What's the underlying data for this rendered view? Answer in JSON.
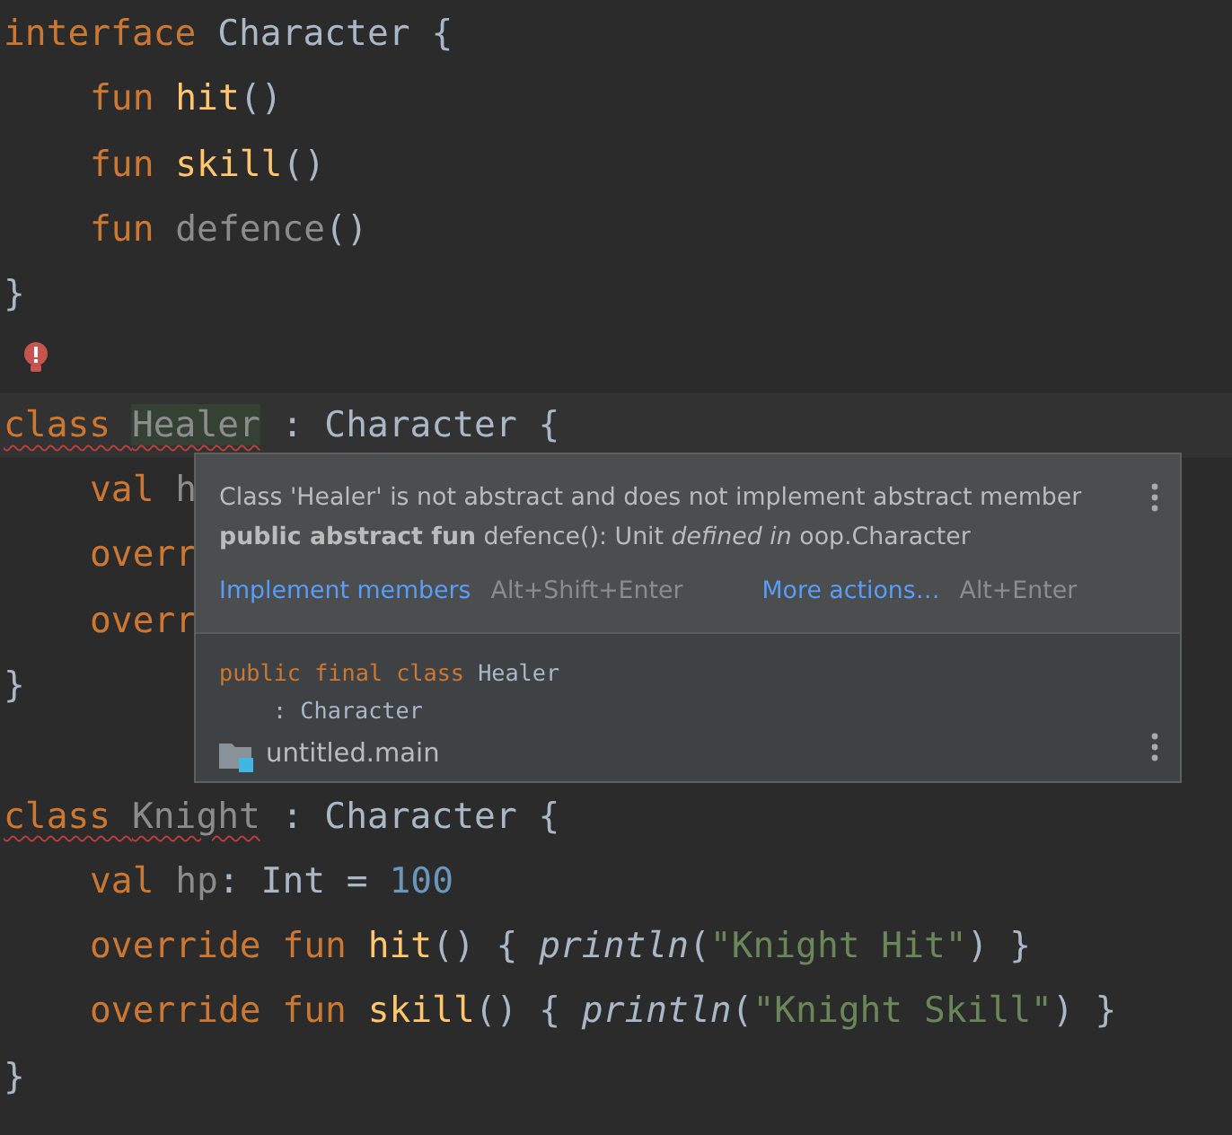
{
  "editor": {
    "lines": [
      {
        "kind": "code",
        "tokens": [
          {
            "kind": "kw",
            "text": "interface"
          },
          {
            "kind": "plain",
            "text": " Character {"
          }
        ]
      },
      {
        "kind": "code",
        "indent": true,
        "tokens": [
          {
            "kind": "kw",
            "text": "fun "
          },
          {
            "kind": "fn",
            "text": "hit"
          },
          {
            "kind": "plain",
            "text": "()"
          }
        ]
      },
      {
        "kind": "code",
        "indent": true,
        "tokens": [
          {
            "kind": "kw",
            "text": "fun "
          },
          {
            "kind": "fn",
            "text": "skill"
          },
          {
            "kind": "plain",
            "text": "()"
          }
        ]
      },
      {
        "kind": "code",
        "indent": true,
        "tokens": [
          {
            "kind": "kw",
            "text": "fun "
          },
          {
            "kind": "muted",
            "text": "defence"
          },
          {
            "kind": "plain",
            "text": "()"
          }
        ]
      },
      {
        "kind": "code",
        "tokens": [
          {
            "kind": "plain",
            "text": "}"
          }
        ]
      },
      {
        "kind": "bulb"
      },
      {
        "kind": "code",
        "current": true,
        "tokens": [
          {
            "kind": "kw",
            "text": "class ",
            "error": true
          },
          {
            "kind": "muted",
            "text": "Healer",
            "error": true,
            "highlighted": true
          },
          {
            "kind": "plain",
            "text": " : Character {"
          }
        ]
      },
      {
        "kind": "code",
        "indent": true,
        "tokens": [
          {
            "kind": "kw",
            "text": "val "
          },
          {
            "kind": "muted",
            "text": "h"
          }
        ]
      },
      {
        "kind": "code",
        "indent": true,
        "tokens": [
          {
            "kind": "kw",
            "text": "overr"
          }
        ]
      },
      {
        "kind": "code",
        "indent": true,
        "tokens": [
          {
            "kind": "kw",
            "text": "overr"
          }
        ]
      },
      {
        "kind": "code",
        "tokens": [
          {
            "kind": "plain",
            "text": "}"
          }
        ]
      },
      {
        "kind": "blank"
      },
      {
        "kind": "code",
        "tokens": [
          {
            "kind": "kw",
            "text": "class ",
            "error": true
          },
          {
            "kind": "muted",
            "text": "Knight",
            "error": true
          },
          {
            "kind": "plain",
            "text": " : Character {"
          }
        ]
      },
      {
        "kind": "code",
        "indent": true,
        "tokens": [
          {
            "kind": "kw",
            "text": "val "
          },
          {
            "kind": "muted",
            "text": "hp"
          },
          {
            "kind": "plain",
            "text": ": Int = "
          },
          {
            "kind": "num",
            "text": "100"
          }
        ]
      },
      {
        "kind": "code",
        "indent": true,
        "tokens": [
          {
            "kind": "kw",
            "text": "override fun "
          },
          {
            "kind": "fn",
            "text": "hit"
          },
          {
            "kind": "plain",
            "text": "() { "
          },
          {
            "kind": "call",
            "text": "println"
          },
          {
            "kind": "plain",
            "text": "("
          },
          {
            "kind": "str",
            "text": "\"Knight Hit\""
          },
          {
            "kind": "plain",
            "text": ") }"
          }
        ]
      },
      {
        "kind": "code",
        "indent": true,
        "tokens": [
          {
            "kind": "kw",
            "text": "override fun "
          },
          {
            "kind": "fn",
            "text": "skill"
          },
          {
            "kind": "plain",
            "text": "() { "
          },
          {
            "kind": "call",
            "text": "println"
          },
          {
            "kind": "plain",
            "text": "("
          },
          {
            "kind": "str",
            "text": "\"Knight Skill\""
          },
          {
            "kind": "plain",
            "text": ") }"
          }
        ]
      },
      {
        "kind": "code",
        "tokens": [
          {
            "kind": "plain",
            "text": "}"
          }
        ]
      }
    ]
  },
  "popup": {
    "message": "Class 'Healer' is not abstract and does not implement abstract member",
    "detail": "**public abstract fun** defence(): Unit *defined in* oop.Character",
    "actions": [
      {
        "label": "Implement members",
        "shortcut": "Alt+Shift+Enter"
      },
      {
        "label": "More actions…",
        "shortcut": "Alt+Enter"
      }
    ],
    "declaration": [
      {
        "tokens": [
          {
            "kind": "kw",
            "text": "public final class "
          },
          {
            "kind": "plain",
            "text": "Healer"
          }
        ]
      },
      {
        "indent": true,
        "tokens": [
          {
            "kind": "plain",
            "text": ": Character"
          }
        ]
      }
    ],
    "module": "untitled.main"
  }
}
